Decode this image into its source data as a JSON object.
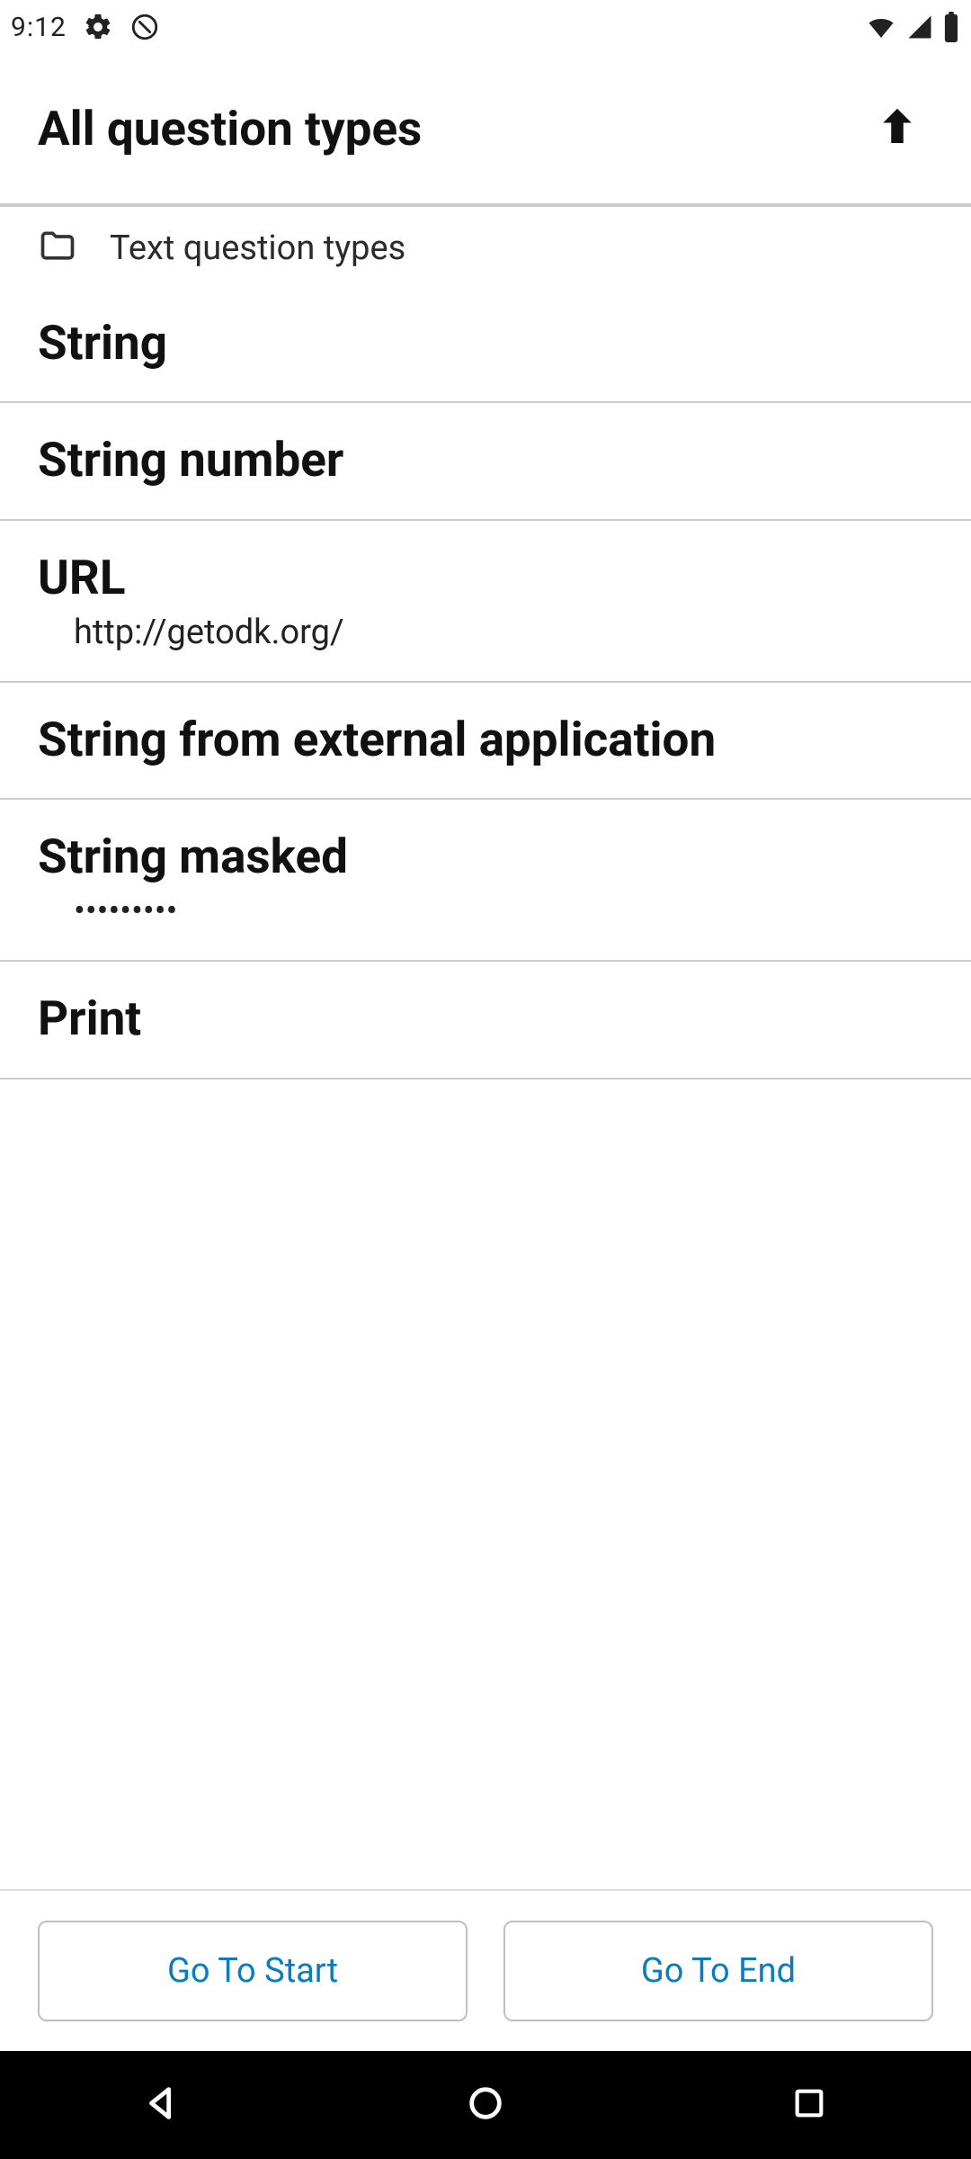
{
  "status_bar": {
    "time": "9:12"
  },
  "app_bar": {
    "title": "All question types"
  },
  "section_header": {
    "label": "Text question types"
  },
  "list": {
    "items": [
      {
        "title": "String",
        "subtitle": null
      },
      {
        "title": "String number",
        "subtitle": null
      },
      {
        "title": "URL",
        "subtitle": "http://getodk.org/"
      },
      {
        "title": "String from external application",
        "subtitle": null
      },
      {
        "title": "String masked",
        "subtitle": "•••••••••"
      },
      {
        "title": "Print",
        "subtitle": null
      }
    ]
  },
  "footer": {
    "start_label": "Go To Start",
    "end_label": "Go To End"
  }
}
